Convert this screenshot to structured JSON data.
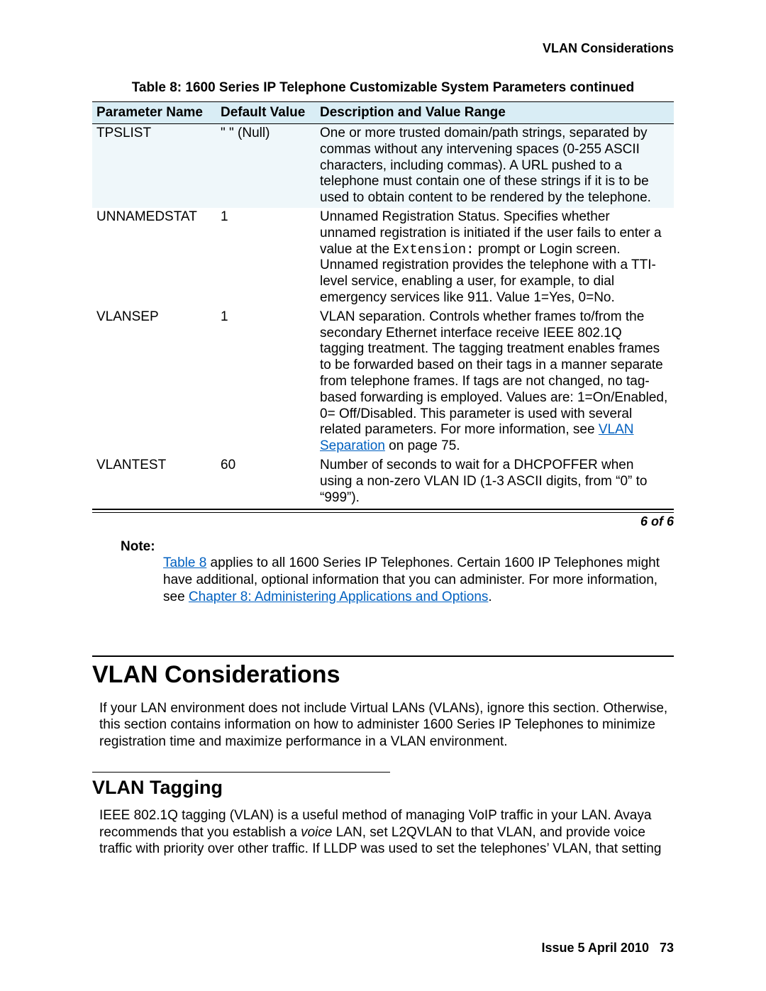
{
  "header": {
    "running_head": "VLAN Considerations"
  },
  "table": {
    "caption": "Table 8: 1600 Series IP Telephone Customizable System Parameters  continued",
    "headers": [
      "Parameter Name",
      "Default Value",
      "Description and Value Range"
    ],
    "rows": [
      {
        "name": "TPSLIST",
        "default": "\" \" (Null)",
        "desc": "One or more trusted domain/path strings, separated by commas without any intervening spaces (0-255 ASCII characters, including commas). A URL pushed to a telephone must contain one of these strings if it is to be used to obtain content to be rendered by the telephone."
      },
      {
        "name": "UNNAMEDSTAT",
        "default": "1",
        "desc_pre": "Unnamed Registration Status. Specifies whether unnamed registration is initiated if the user fails to enter a value at the ",
        "desc_mono": "Extension:",
        "desc_post": " prompt or Login screen. Unnamed registration provides the telephone with a TTI-level service, enabling a user, for example, to dial emergency services like 911. Value 1=Yes, 0=No."
      },
      {
        "name": "VLANSEP",
        "default": "1",
        "desc_pre": "VLAN separation. Controls whether frames to/from the secondary Ethernet interface receive IEEE 802.1Q tagging treatment. The tagging treatment enables frames to be forwarded based on their tags in a manner separate from telephone frames. If tags are not changed, no tag-based forwarding is employed. Values are: 1=On/Enabled, 0= Off/Disabled. This parameter is used with several related parameters. For more information, see ",
        "desc_link": "VLAN Separation",
        "desc_post": " on page 75."
      },
      {
        "name": "VLANTEST",
        "default": "60",
        "desc": "Number of seconds to wait for a DHCPOFFER when using a non-zero VLAN ID (1-3 ASCII digits, from “0” to “999”)."
      }
    ],
    "pager": "6 of 6"
  },
  "note": {
    "label": "Note:",
    "link1": "Table 8",
    "text_mid": " applies to all 1600 Series IP Telephones. Certain 1600 IP Telephones might have additional, optional information that you can administer. For more information, see ",
    "link2": "Chapter 8: Administering Applications and Options",
    "text_end": "."
  },
  "sections": {
    "h1": "VLAN Considerations",
    "p1": "If your LAN environment does not include Virtual LANs (VLANs), ignore this section. Otherwise, this section contains information on how to administer 1600 Series IP Telephones to minimize registration time and maximize performance in a VLAN environment.",
    "h2": "VLAN Tagging",
    "p2_pre": "IEEE 802.1Q tagging (VLAN) is a useful method of managing VoIP traffic in your LAN. Avaya recommends that you establish a ",
    "p2_ital": "voice",
    "p2_post": " LAN, set L2QVLAN to that VLAN, and provide voice traffic with priority over other traffic. If LLDP was used to set the telephones’ VLAN, that setting"
  },
  "footer": {
    "issue": "Issue 5   April 2010",
    "page": "73"
  }
}
